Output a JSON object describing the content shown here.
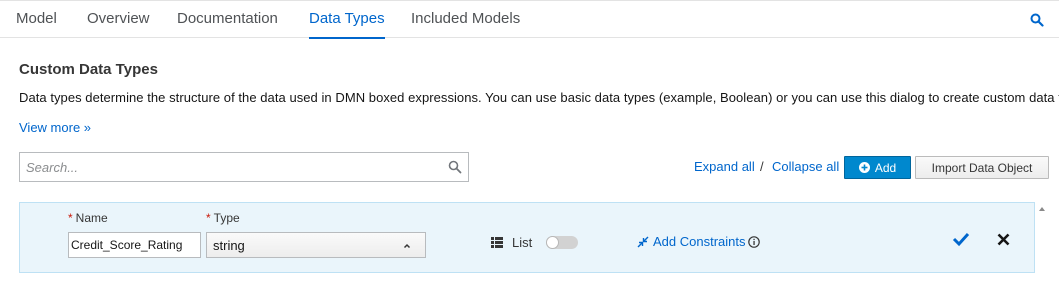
{
  "tabs": [
    {
      "label": "Model"
    },
    {
      "label": "Overview"
    },
    {
      "label": "Documentation"
    },
    {
      "label": "Data Types",
      "active": true
    },
    {
      "label": "Included Models"
    }
  ],
  "section": {
    "title": "Custom Data Types",
    "description": "Data types determine the structure of the data used in DMN boxed expressions. You can use basic data types (example, Boolean) or you can use this dialog to create custom data types.",
    "view_more": "View more »"
  },
  "search": {
    "placeholder": "Search...",
    "value": ""
  },
  "toolbar": {
    "expand_all": "Expand all",
    "separator": "/",
    "collapse_all": "Collapse all",
    "add_label": "Add",
    "import_label": "Import Data Object"
  },
  "data_type_row": {
    "name_label": "Name",
    "type_label": "Type",
    "required_marker": "*",
    "name_value": "Credit_Score_Rating",
    "type_value": "string",
    "list_label": "List",
    "list_enabled": false,
    "add_constraints_label": "Add Constraints"
  },
  "colors": {
    "accent": "#0066cc",
    "primary_button": "#0088ce",
    "row_background": "#eaf5fb",
    "required": "#c9190b"
  },
  "icons": {
    "tab_search": "search-icon",
    "search": "search-icon",
    "add": "plus-circle-icon",
    "type_dropdown": "chevron-up-icon",
    "list": "list-icon",
    "constraints": "compress-icon",
    "info": "info-circle-icon",
    "save": "check-icon",
    "cancel": "close-icon"
  }
}
